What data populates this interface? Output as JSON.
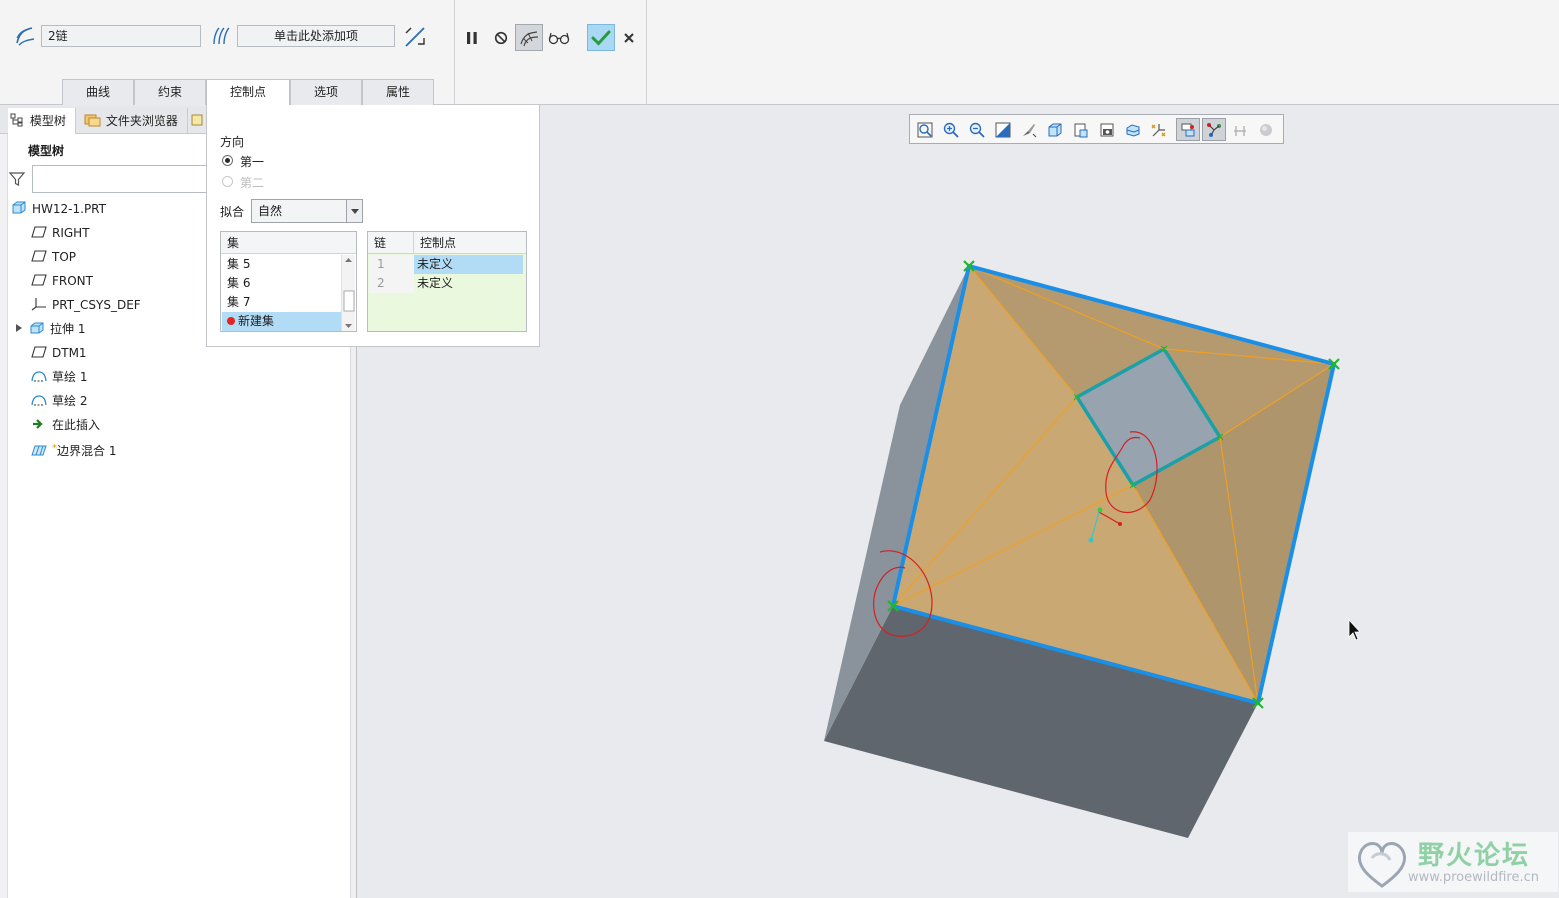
{
  "dashboard": {
    "chain_collector_value": "2链",
    "add_item_placeholder": "单击此处添加项",
    "tabs": [
      {
        "label": "曲线"
      },
      {
        "label": "约束"
      },
      {
        "label": "控制点"
      },
      {
        "label": "选项"
      },
      {
        "label": "属性"
      }
    ],
    "active_tab": "控制点",
    "accent_color": "#2b9a3c"
  },
  "control_points_panel": {
    "direction_label": "方向",
    "direction_options": [
      {
        "label": "第一",
        "selected": true,
        "enabled": true
      },
      {
        "label": "第二",
        "selected": false,
        "enabled": false
      }
    ],
    "fit_label": "拟合",
    "fit_value": "自然",
    "sets_header": "集",
    "sets": [
      {
        "label": "集 5"
      },
      {
        "label": "集 6"
      },
      {
        "label": "集 7"
      },
      {
        "label": "新建集"
      }
    ],
    "table_headers": {
      "chain": "链",
      "control_point": "控制点"
    },
    "table_rows": [
      {
        "chain": "1",
        "control_point": "未定义"
      },
      {
        "chain": "2",
        "control_point": "未定义"
      }
    ]
  },
  "navigator": {
    "tabs": [
      {
        "label": "模型树"
      },
      {
        "label": "文件夹浏览器"
      }
    ],
    "tree_heading": "模型树",
    "tree_items": [
      {
        "label": "HW12-1.PRT",
        "icon": "part-icon"
      },
      {
        "label": "RIGHT",
        "icon": "datum-plane-icon"
      },
      {
        "label": "TOP",
        "icon": "datum-plane-icon"
      },
      {
        "label": "FRONT",
        "icon": "datum-plane-icon"
      },
      {
        "label": "PRT_CSYS_DEF",
        "icon": "csys-icon"
      },
      {
        "label": "拉伸 1",
        "icon": "extrude-icon"
      },
      {
        "label": "DTM1",
        "icon": "datum-plane-icon"
      },
      {
        "label": "草绘 1",
        "icon": "sketch-icon"
      },
      {
        "label": "草绘 2",
        "icon": "sketch-icon"
      },
      {
        "label": "在此插入",
        "icon": "insert-arrow-icon"
      },
      {
        "label": "边界混合 1",
        "icon": "boundary-blend-icon"
      }
    ]
  },
  "watermark": {
    "title": "野火论坛",
    "url": "www.proewildfire.cn"
  }
}
